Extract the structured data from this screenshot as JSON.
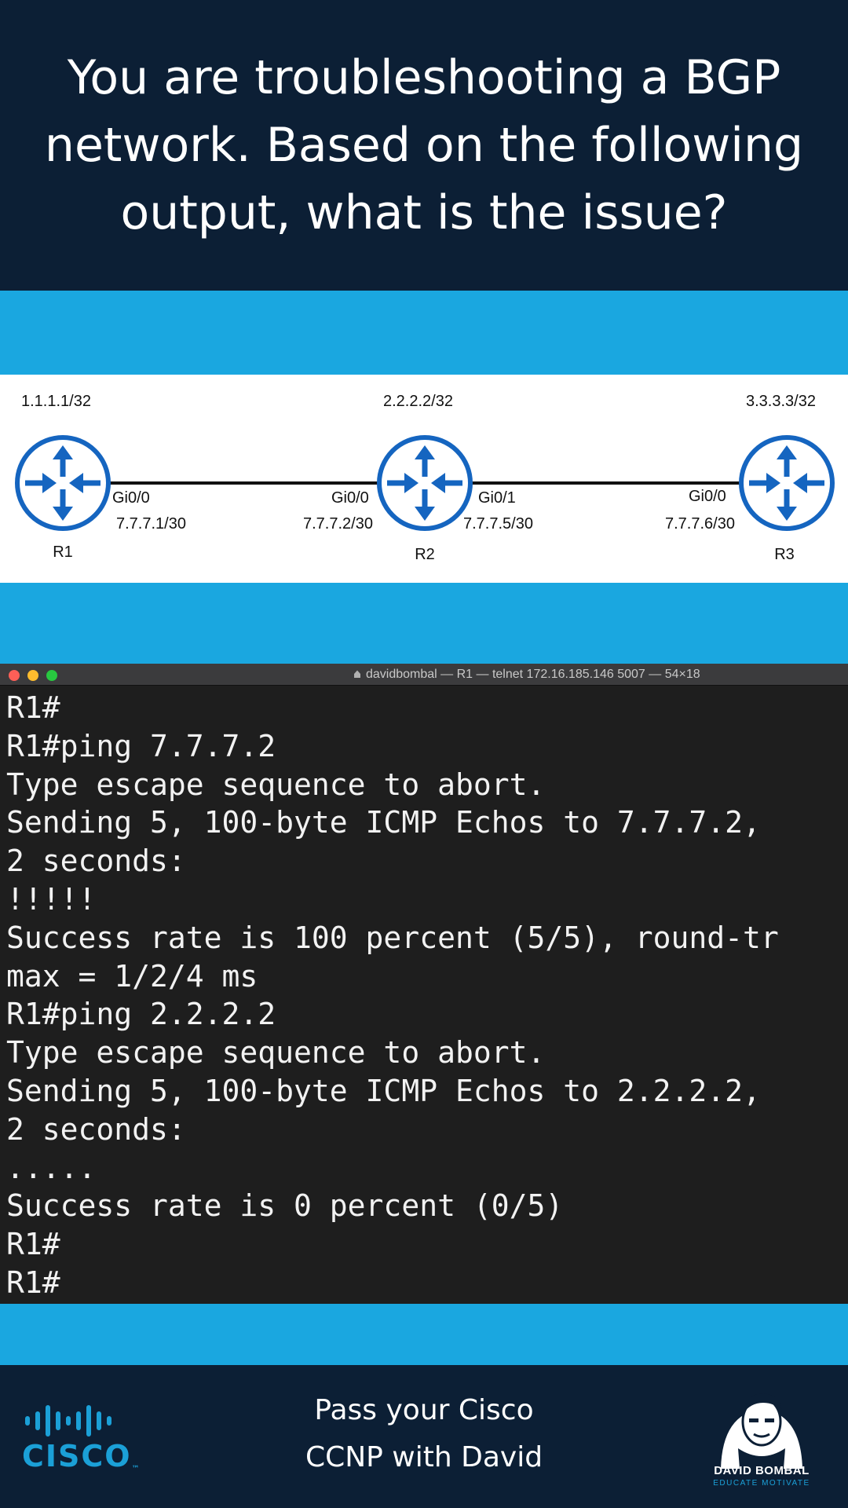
{
  "header": {
    "title": "You are troubleshooting a BGP network. Based on the following output, what is the issue?"
  },
  "topology": {
    "routers": [
      {
        "name": "R1",
        "loopback": "1.1.1.1/32"
      },
      {
        "name": "R2",
        "loopback": "2.2.2.2/32"
      },
      {
        "name": "R3",
        "loopback": "3.3.3.3/32"
      }
    ],
    "links": [
      {
        "a_intf": "Gi0/0",
        "a_ip": "7.7.7.1/30",
        "b_intf": "Gi0/0",
        "b_ip": "7.7.7.2/30"
      },
      {
        "a_intf": "Gi0/1",
        "a_ip": "7.7.7.5/30",
        "b_intf": "Gi0/0",
        "b_ip": "7.7.7.6/30"
      }
    ],
    "router_color": "#1565c0"
  },
  "terminal": {
    "title": "davidbombal — R1 — telnet 172.16.185.146 5007 — 54×18",
    "lines": [
      "R1#",
      "R1#ping 7.7.7.2",
      "Type escape sequence to abort.",
      "Sending 5, 100-byte ICMP Echos to 7.7.7.2,",
      "2 seconds:",
      "!!!!!",
      "Success rate is 100 percent (5/5), round-tr",
      "max = 1/2/4 ms",
      "R1#ping 2.2.2.2",
      "Type escape sequence to abort.",
      "Sending 5, 100-byte ICMP Echos to 2.2.2.2,",
      "2 seconds:",
      ".....",
      "Success rate is 0 percent (0/5)",
      "R1#",
      "R1#"
    ]
  },
  "footer": {
    "line1": "Pass your Cisco",
    "line2": "CCNP with David",
    "cisco_logo_text": "CISCO",
    "bombal_logo_name": "DAVID BOMBAL",
    "bombal_logo_tagline": "EDUCATE MOTIVATE"
  },
  "colors": {
    "navy": "#0c1f35",
    "accent_blue": "#1aa7e0",
    "terminal_bg": "#1e1e1e"
  }
}
